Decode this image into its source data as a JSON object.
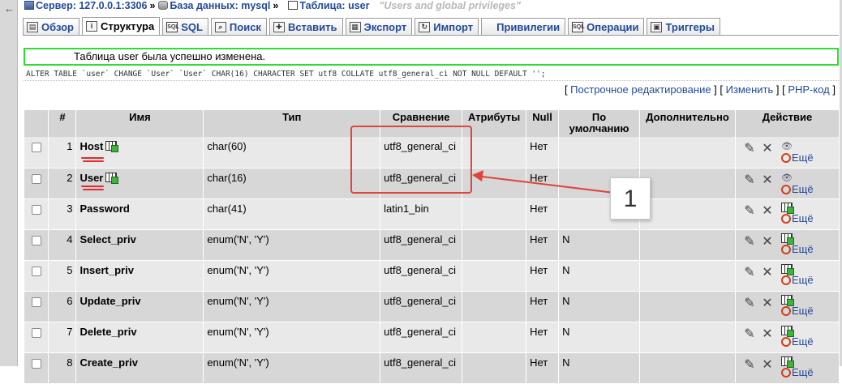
{
  "breadcrumb": {
    "server": "Сервер: 127.0.0.1:3306",
    "database": "База данных: mysql",
    "table": "Таблица: user",
    "comment": "\"Users and global privileges\""
  },
  "tabs": [
    {
      "label": "Обзор",
      "icon": "browse-icon"
    },
    {
      "label": "Структура",
      "icon": "structure-icon",
      "active": true
    },
    {
      "label": "SQL",
      "icon": "sql-icon"
    },
    {
      "label": "Поиск",
      "icon": "search-icon"
    },
    {
      "label": "Вставить",
      "icon": "insert-icon"
    },
    {
      "label": "Экспорт",
      "icon": "export-icon"
    },
    {
      "label": "Импорт",
      "icon": "import-icon"
    },
    {
      "label": "Привилегии",
      "icon": "privileges-icon"
    },
    {
      "label": "Операции",
      "icon": "operations-icon"
    },
    {
      "label": "Триггеры",
      "icon": "triggers-icon"
    }
  ],
  "message": {
    "success": "Таблица user была успешно изменена.",
    "sql": "ALTER TABLE `user` CHANGE `User` `User` CHAR(16) CHARACTER SET utf8 COLLATE utf8_general_ci NOT NULL DEFAULT '';",
    "links": [
      "Построчное редактирование",
      "Изменить",
      "PHP-код"
    ]
  },
  "table": {
    "headers": [
      "#",
      "Имя",
      "Тип",
      "Сравнение",
      "Атрибуты",
      "Null",
      "По умолчанию",
      "Дополнительно",
      "Действие"
    ],
    "rows": [
      {
        "num": "1",
        "name": "Host",
        "type": "char(60)",
        "collation": "utf8_general_ci",
        "attributes": "",
        "null": "Нет",
        "default": "",
        "extra": "",
        "more": "Ещё",
        "key": true
      },
      {
        "num": "2",
        "name": "User",
        "type": "char(16)",
        "collation": "utf8_general_ci",
        "attributes": "",
        "null": "Нет",
        "default": "",
        "extra": "",
        "more": "Ещё",
        "key": true
      },
      {
        "num": "3",
        "name": "Password",
        "type": "char(41)",
        "collation": "latin1_bin",
        "attributes": "",
        "null": "Нет",
        "default": "",
        "extra": "",
        "more": "Ещё"
      },
      {
        "num": "4",
        "name": "Select_priv",
        "type": "enum('N', 'Y')",
        "collation": "utf8_general_ci",
        "attributes": "",
        "null": "Нет",
        "default": "N",
        "extra": "",
        "more": "Ещё"
      },
      {
        "num": "5",
        "name": "Insert_priv",
        "type": "enum('N', 'Y')",
        "collation": "utf8_general_ci",
        "attributes": "",
        "null": "Нет",
        "default": "N",
        "extra": "",
        "more": "Ещё"
      },
      {
        "num": "6",
        "name": "Update_priv",
        "type": "enum('N', 'Y')",
        "collation": "utf8_general_ci",
        "attributes": "",
        "null": "Нет",
        "default": "N",
        "extra": "",
        "more": "Ещё"
      },
      {
        "num": "7",
        "name": "Delete_priv",
        "type": "enum('N', 'Y')",
        "collation": "utf8_general_ci",
        "attributes": "",
        "null": "Нет",
        "default": "N",
        "extra": "",
        "more": "Ещё"
      },
      {
        "num": "8",
        "name": "Create_priv",
        "type": "enum('N', 'Y')",
        "collation": "utf8_general_ci",
        "attributes": "",
        "null": "Нет",
        "default": "N",
        "extra": "",
        "more": "Ещё"
      }
    ]
  },
  "annotation": {
    "callout": "1",
    "color": "#e0443a"
  }
}
